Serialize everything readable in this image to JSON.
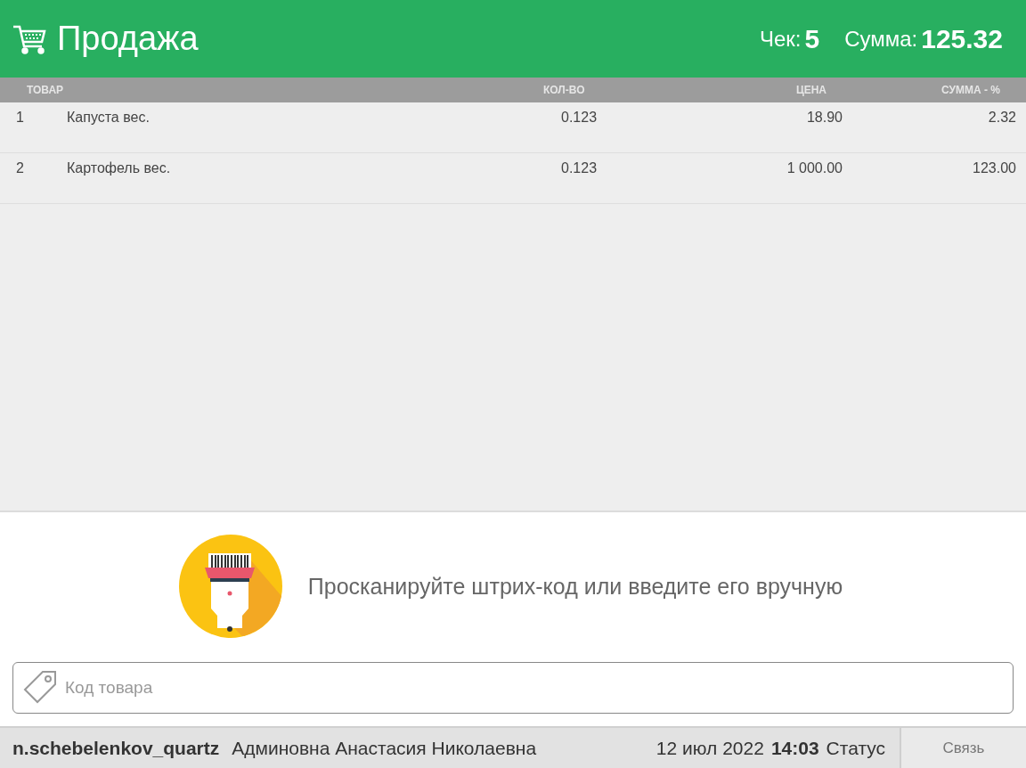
{
  "header": {
    "title": "Продажа",
    "receipt_label": "Чек:",
    "receipt_number": "5",
    "total_label": "Сумма:",
    "total_value": "125.32"
  },
  "table": {
    "columns": [
      "ТОВАР",
      "КОЛ-ВО",
      "ЦЕНА",
      "СУММА - %"
    ],
    "rows": [
      {
        "index": "1",
        "name": "Капуста вес.",
        "quantity": "0.123",
        "price": "18.90",
        "sum": "2.32"
      },
      {
        "index": "2",
        "name": "Картофель вес.",
        "quantity": "0.123",
        "price": "1 000.00",
        "sum": "123.00"
      }
    ]
  },
  "scan_prompt": "Просканируйте штрих-код или введите его вручную",
  "code_field": {
    "placeholder": "Код товара"
  },
  "status_bar": {
    "login": "n.schebelenkov_quartz",
    "user_name": "Админовна Анастасия Николаевна",
    "date": "12 июл 2022",
    "time": "14:03",
    "status": "Статус",
    "connection_button": "Связь"
  }
}
